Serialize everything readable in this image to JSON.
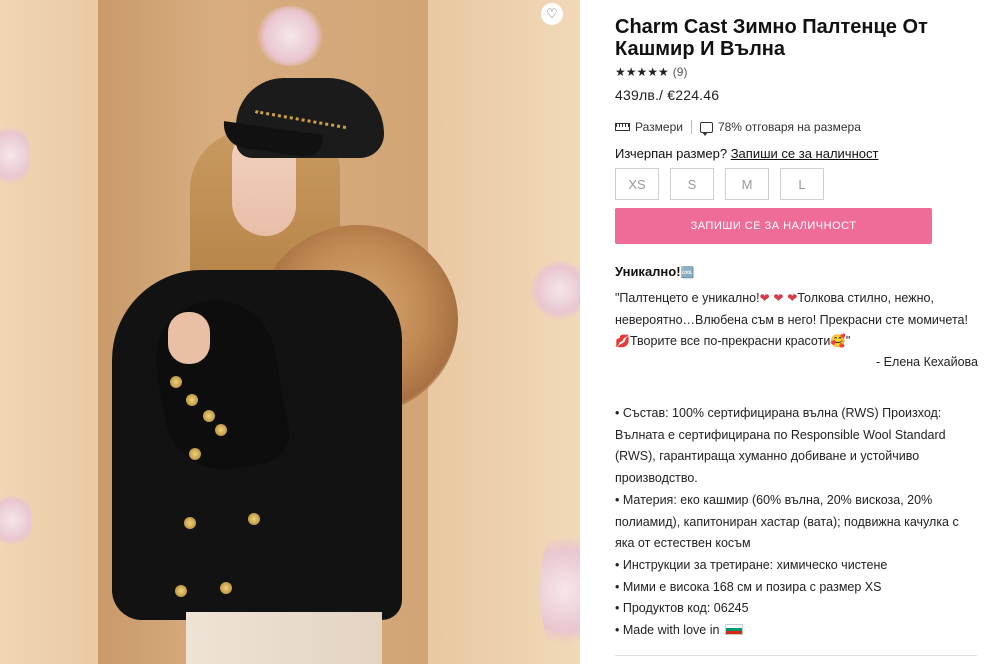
{
  "product": {
    "title": "Charm Cast Зимно Палтенце От Кашмир И Вълна",
    "rating_stars": "★★★★★",
    "review_count": "(9)",
    "price": "439лв./ €224.46"
  },
  "size_info": {
    "sizes_link": "Размери",
    "fit_text": "78% отговаря на размера",
    "out_of_stock_label": "Изчерпан размер?",
    "notify_link": "Запиши се за наличност",
    "options": [
      "XS",
      "S",
      "M",
      "L"
    ],
    "notify_button": "ЗАПИШИ СЕ ЗА НАЛИЧНОСТ"
  },
  "description": {
    "heading": "Уникално!",
    "heading_emoji": "🆒",
    "quote_part1": "\"Палтенцето е уникално!",
    "hearts": "❤ ❤ ❤",
    "quote_part2": "Толкова стилно, нежно, невероятно…Влюбена съм в него! Прекрасни сте момичета!",
    "kiss_emoji": "💋",
    "quote_part3": "Творите все по-прекрасни красоти",
    "smile_emoji": "🥰",
    "quote_end": "\"",
    "author": "- Елена Кехайова",
    "specs": [
      "• Състав: 100% сертифицирана вълна (RWS) Произход: Вълната е сертифицирана по Responsible Wool Standard (RWS), гарантираща хуманно добиване и устойчиво производство.",
      "• Материя: еко кашмир (60% вълна, 20% вискоза, 20% полиамид), капитониран хастар (вата); подвижна качулка с яка от естествен косъм",
      "• Инструкции за третиране: химическо чистене",
      "• Мими е висока 168 см и позира с размер XS",
      "• Продуктов код: 06245",
      "• Made with love in"
    ]
  },
  "icons": {
    "wishlist": "heart-outline-icon",
    "ruler": "ruler-icon",
    "chat": "chat-icon",
    "flag": "bulgaria-flag-icon"
  },
  "colors": {
    "accent": "#ef6b98",
    "text": "#222222",
    "size_border": "#cfcfcf"
  }
}
